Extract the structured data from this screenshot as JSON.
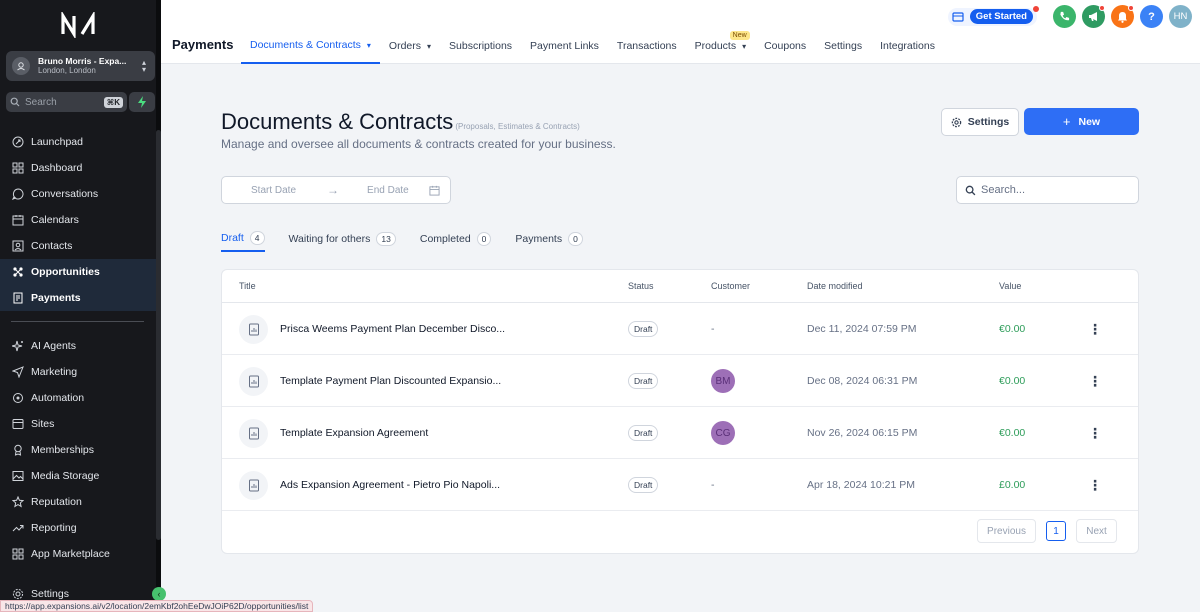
{
  "sidebar": {
    "account": {
      "name": "Bruno Morris - Expa...",
      "location": "London, London"
    },
    "search": {
      "placeholder": "Search",
      "shortcut": "⌘K"
    },
    "items_top": [
      {
        "label": "Launchpad",
        "icon": "rocket-icon"
      },
      {
        "label": "Dashboard",
        "icon": "dashboard-icon"
      },
      {
        "label": "Conversations",
        "icon": "chat-icon"
      },
      {
        "label": "Calendars",
        "icon": "calendar-icon"
      },
      {
        "label": "Contacts",
        "icon": "contacts-icon"
      },
      {
        "label": "Opportunities",
        "icon": "opportunities-icon"
      },
      {
        "label": "Payments",
        "icon": "payments-icon"
      }
    ],
    "items_bottom": [
      {
        "label": "AI Agents",
        "icon": "sparkle-icon"
      },
      {
        "label": "Marketing",
        "icon": "send-icon"
      },
      {
        "label": "Automation",
        "icon": "automation-icon"
      },
      {
        "label": "Sites",
        "icon": "globe-icon"
      },
      {
        "label": "Memberships",
        "icon": "membership-icon"
      },
      {
        "label": "Media Storage",
        "icon": "image-icon"
      },
      {
        "label": "Reputation",
        "icon": "star-icon"
      },
      {
        "label": "Reporting",
        "icon": "trend-icon"
      },
      {
        "label": "App Marketplace",
        "icon": "grid-icon"
      },
      {
        "label": "Settings",
        "icon": "gear-icon"
      }
    ]
  },
  "topbar": {
    "title": "Payments",
    "tabs": [
      {
        "label": "Documents & Contracts",
        "dropdown": true,
        "active": true
      },
      {
        "label": "Orders",
        "dropdown": true
      },
      {
        "label": "Subscriptions"
      },
      {
        "label": "Payment Links"
      },
      {
        "label": "Transactions"
      },
      {
        "label": "Products",
        "dropdown": true,
        "badge": "New"
      },
      {
        "label": "Coupons"
      },
      {
        "label": "Settings"
      },
      {
        "label": "Integrations"
      }
    ],
    "get_started": "Get Started",
    "help": "?",
    "avatar_initials": "HN",
    "colors": {
      "phone": "#3bb56b",
      "megaphone": "#2f9b62",
      "bell": "#f97316",
      "help": "#3b82f6",
      "avatar": "#7fb2c9"
    }
  },
  "main": {
    "title": "Documents & Contracts",
    "title_sub": "(Proposals, Estimates & Contracts)",
    "description": "Manage and oversee all documents & contracts created for your business.",
    "settings_button": "Settings",
    "new_button": "New",
    "date_start": "Start Date",
    "date_end": "End Date",
    "search_placeholder": "Search...",
    "tabs": [
      {
        "label": "Draft",
        "count": "4",
        "active": true
      },
      {
        "label": "Waiting for others",
        "count": "13"
      },
      {
        "label": "Completed",
        "count": "0"
      },
      {
        "label": "Payments",
        "count": "0"
      }
    ]
  },
  "table": {
    "columns": [
      "Title",
      "Status",
      "Customer",
      "Date modified",
      "Value"
    ],
    "rows": [
      {
        "title": "Prisca Weems Payment Plan December Disco...",
        "status": "Draft",
        "customer": "-",
        "date": "Dec 11, 2024 07:59 PM",
        "value": "€0.00"
      },
      {
        "title": "Template Payment Plan Discounted Expansio...",
        "status": "Draft",
        "customer": "BM",
        "date": "Dec 08, 2024 06:31 PM",
        "value": "€0.00"
      },
      {
        "title": "Template Expansion Agreement",
        "status": "Draft",
        "customer": "CG",
        "date": "Nov 26, 2024 06:15 PM",
        "value": "€0.00"
      },
      {
        "title": "Ads Expansion Agreement - Pietro Pio Napoli...",
        "status": "Draft",
        "customer": "-",
        "date": "Apr 18, 2024 10:21 PM",
        "value": "£0.00"
      }
    ],
    "value_color": "#2e9d5a",
    "pager": {
      "previous": "Previous",
      "page": "1",
      "next": "Next"
    }
  },
  "status_url": "https://app.expansions.ai/v2/location/2emKbf2ohEeDwJOiP62D/opportunities/list"
}
